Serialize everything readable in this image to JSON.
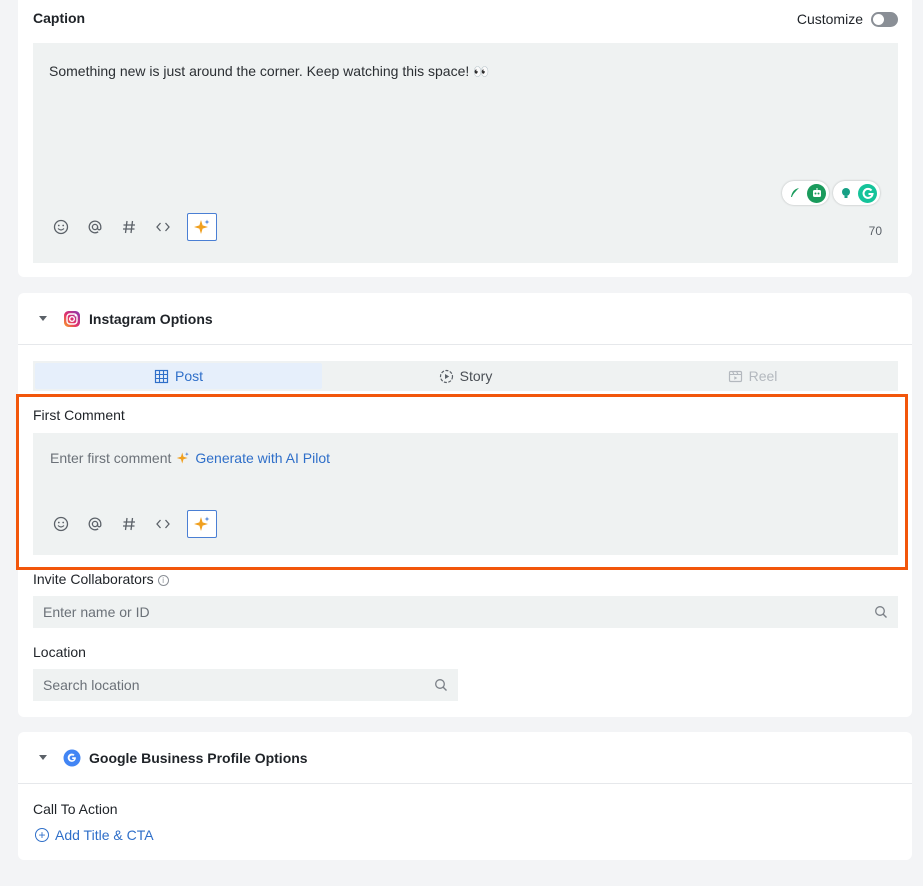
{
  "caption": {
    "title": "Caption",
    "customize_label": "Customize",
    "text": "Something new is just around the corner. Keep watching this space!",
    "emoji": "👀",
    "char_count": "70"
  },
  "instagram": {
    "title": "Instagram Options",
    "tabs": [
      {
        "label": "Post",
        "state": "active"
      },
      {
        "label": "Story",
        "state": "normal"
      },
      {
        "label": "Reel",
        "state": "disabled"
      }
    ],
    "first_comment": {
      "label": "First Comment",
      "placeholder": "Enter first comment",
      "generate_label": "Generate with AI Pilot"
    },
    "collaborators": {
      "label": "Invite Collaborators",
      "placeholder": "Enter name or ID"
    },
    "location": {
      "label": "Location",
      "placeholder": "Search location"
    }
  },
  "google": {
    "title": "Google Business Profile Options",
    "cta_label": "Call To Action",
    "add_cta": "Add Title & CTA"
  },
  "colors": {
    "accent": "#2f6fc9",
    "highlight": "#f2560b",
    "ai_spark": "#f0a020"
  },
  "icons": {
    "toolbar": [
      "emoji-icon",
      "mention-icon",
      "hashtag-icon",
      "code-icon",
      "ai-sparkle-icon"
    ]
  }
}
